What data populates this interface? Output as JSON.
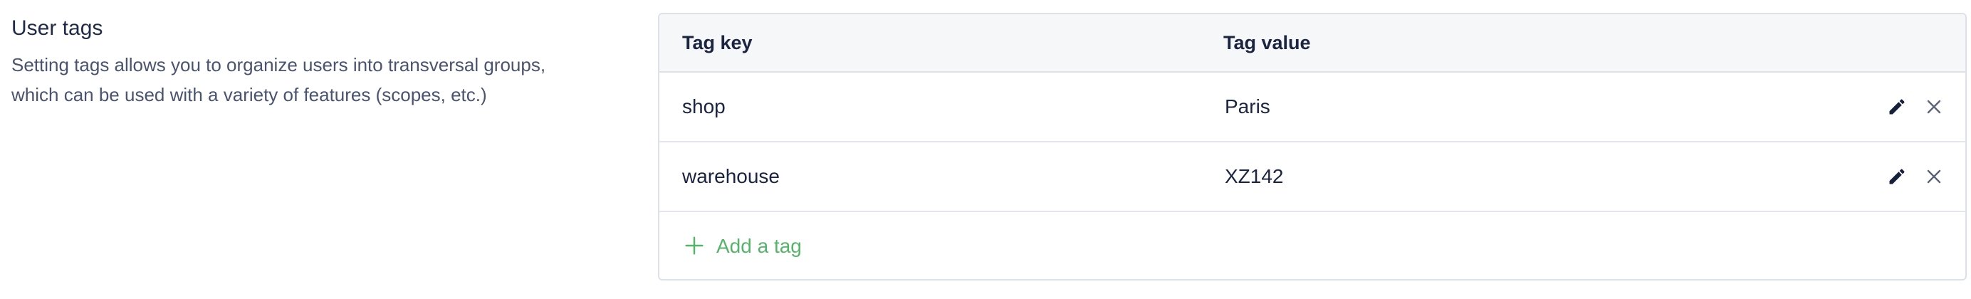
{
  "section": {
    "title": "User tags",
    "description_line1": "Setting tags allows you to organize users into transversal groups,",
    "description_line2": "which can be used with a variety of features (scopes, etc.)"
  },
  "table": {
    "headers": {
      "key": "Tag key",
      "value": "Tag value"
    },
    "rows": [
      {
        "key": "shop",
        "value": "Paris",
        "actions": [
          "pencil-icon",
          "close-icon"
        ]
      },
      {
        "key": "warehouse",
        "value": "XZ142",
        "actions": [
          "pencil-icon",
          "close-icon"
        ]
      }
    ],
    "add_label": "Add a tag",
    "add_icon": "plus-icon"
  },
  "colors": {
    "text": "#1b2440",
    "muted": "#4a5470",
    "accent_green": "#56b36a",
    "icon_dark": "#16203a",
    "icon_gray": "#5b6478",
    "header_bg": "#f6f7f9",
    "border": "#dde1e8"
  }
}
